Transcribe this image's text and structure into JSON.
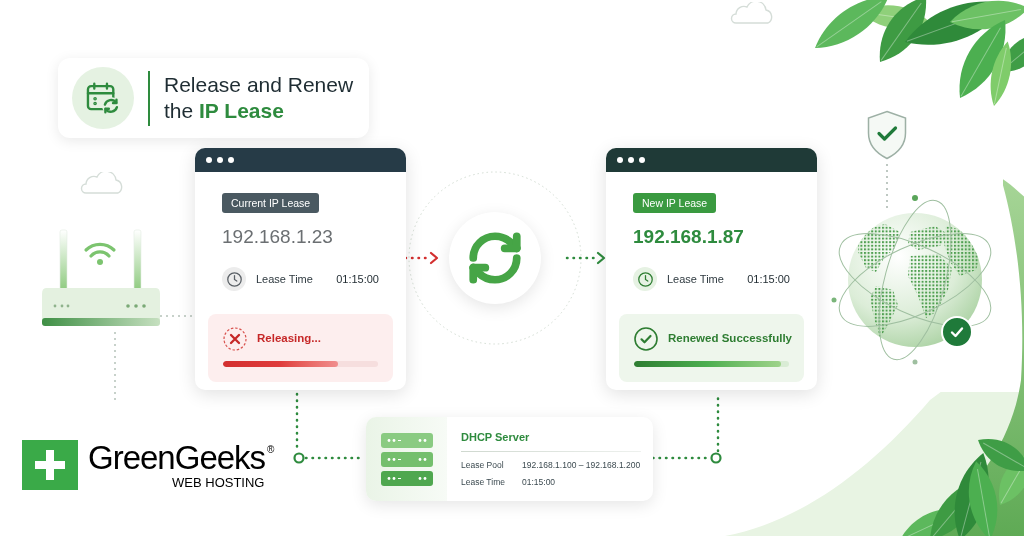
{
  "heading": {
    "lines": [
      "Release and Renew",
      "the **IP Lease**"
    ]
  },
  "cards": [
    {
      "kind": "releasing",
      "badge": "Current IP Lease",
      "ip": "192.168.1.23",
      "lease_label": "Lease Time",
      "lease_time": "01:15:00",
      "status": "Releasing...",
      "level": 0.74
    },
    {
      "kind": "renewed",
      "badge": "New IP Lease",
      "ip": "192.168.1.87",
      "lease_label": "Lease Time",
      "lease_time": "01:15:00",
      "status": "Renewed Successfully",
      "level": 0.95
    }
  ],
  "server": {
    "title": "DHCP Server",
    "rows": [
      {
        "label": "Lease Pool",
        "value": "192.168.1.100 – 192.168.1.200"
      },
      {
        "label": "Lease Time",
        "value": "01:15:00"
      }
    ]
  },
  "logo": {
    "name": "GreenGeeks",
    "mark": "®",
    "tagline": "WEB HOSTING"
  }
}
